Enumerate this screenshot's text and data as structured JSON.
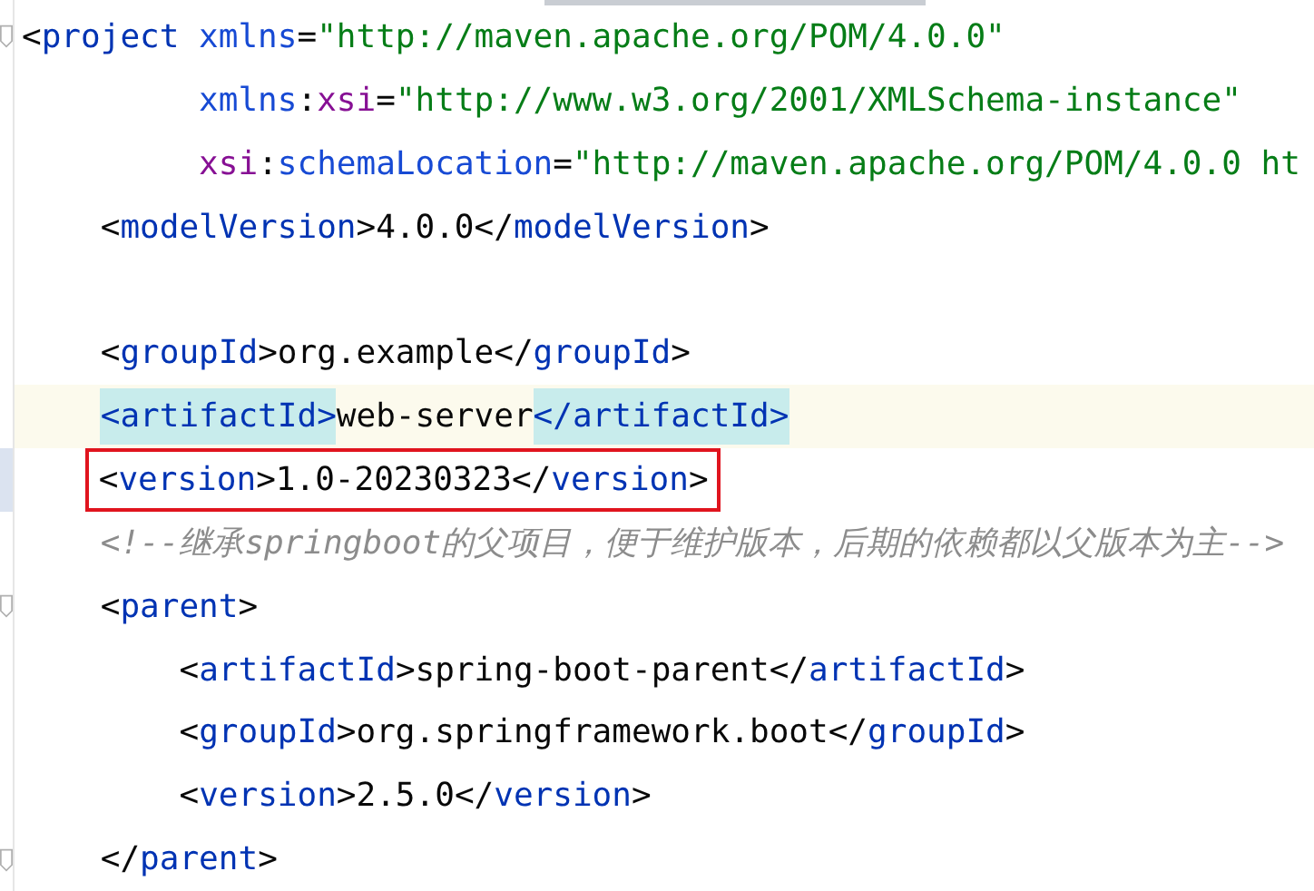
{
  "editor": {
    "lines": [
      {
        "kind": "element",
        "current": false,
        "boxed": false,
        "fold": true,
        "tokens": [
          {
            "kind": "punct",
            "text": "<"
          },
          {
            "kind": "tag",
            "text": "project"
          },
          {
            "kind": "attr",
            "text": " xmlns"
          },
          {
            "kind": "punct",
            "text": "="
          },
          {
            "kind": "value",
            "text": "\"http://maven.apache.org/POM/4.0.0\""
          }
        ],
        "children": [
          {
            "kind": "continuation",
            "current": false,
            "boxed": false,
            "fold": false,
            "tokens": [
              {
                "kind": "attr",
                "text": "xmlns"
              },
              {
                "kind": "punct",
                "text": ":"
              },
              {
                "kind": "ns",
                "text": "xsi"
              },
              {
                "kind": "punct",
                "text": "="
              },
              {
                "kind": "value",
                "text": "\"http://www.w3.org/2001/XMLSchema-instance\""
              }
            ]
          },
          {
            "kind": "continuation",
            "current": false,
            "boxed": false,
            "fold": false,
            "tokens": [
              {
                "kind": "ns",
                "text": "xsi"
              },
              {
                "kind": "punct",
                "text": ":"
              },
              {
                "kind": "attr",
                "text": "schemaLocation"
              },
              {
                "kind": "punct",
                "text": "="
              },
              {
                "kind": "value",
                "text": "\"http://maven.apache.org/POM/4.0.0 ht"
              }
            ]
          },
          {
            "kind": "element",
            "current": false,
            "boxed": false,
            "fold": false,
            "tokens": [
              {
                "kind": "punct",
                "text": "<"
              },
              {
                "kind": "tag",
                "text": "modelVersion"
              },
              {
                "kind": "punct",
                "text": ">4.0.0</"
              },
              {
                "kind": "tag",
                "text": "modelVersion"
              },
              {
                "kind": "punct",
                "text": ">"
              }
            ]
          },
          {
            "kind": "blank",
            "current": false,
            "boxed": false,
            "fold": false
          },
          {
            "kind": "element",
            "current": false,
            "boxed": false,
            "fold": false,
            "tokens": [
              {
                "kind": "punct",
                "text": "<"
              },
              {
                "kind": "tag",
                "text": "groupId"
              },
              {
                "kind": "punct",
                "text": ">org.example</"
              },
              {
                "kind": "tag",
                "text": "groupId"
              },
              {
                "kind": "punct",
                "text": ">"
              }
            ]
          },
          {
            "kind": "element",
            "current": true,
            "boxed": false,
            "fold": false,
            "tokens": [
              {
                "kind": "match",
                "text": "<artifactId>"
              },
              {
                "kind": "punct",
                "text": "web-server"
              },
              {
                "kind": "match",
                "text": "</artifactId>"
              }
            ]
          },
          {
            "kind": "element",
            "current": false,
            "boxed": true,
            "fold": false,
            "tokens": [
              {
                "kind": "punct",
                "text": "<"
              },
              {
                "kind": "tag",
                "text": "version"
              },
              {
                "kind": "punct",
                "text": ">1.0-20230323</"
              },
              {
                "kind": "tag",
                "text": "version"
              },
              {
                "kind": "punct",
                "text": ">"
              }
            ]
          },
          {
            "kind": "comment",
            "current": false,
            "boxed": false,
            "fold": false,
            "tokens": [
              {
                "kind": "comment",
                "text": "<!--继承springboot的父项目，便于维护版本，后期的依赖都以父版本为主-->"
              }
            ]
          },
          {
            "kind": "element",
            "current": false,
            "boxed": false,
            "fold": true,
            "tokens": [
              {
                "kind": "punct",
                "text": "<"
              },
              {
                "kind": "tag",
                "text": "parent"
              },
              {
                "kind": "punct",
                "text": ">"
              }
            ],
            "children": [
              {
                "kind": "element",
                "current": false,
                "boxed": false,
                "fold": false,
                "tokens": [
                  {
                    "kind": "punct",
                    "text": "<"
                  },
                  {
                    "kind": "tag",
                    "text": "artifactId"
                  },
                  {
                    "kind": "punct",
                    "text": ">spring-boot-parent</"
                  },
                  {
                    "kind": "tag",
                    "text": "artifactId"
                  },
                  {
                    "kind": "punct",
                    "text": ">"
                  }
                ]
              },
              {
                "kind": "element",
                "current": false,
                "boxed": false,
                "fold": false,
                "tokens": [
                  {
                    "kind": "punct",
                    "text": "<"
                  },
                  {
                    "kind": "tag",
                    "text": "groupId"
                  },
                  {
                    "kind": "punct",
                    "text": ">org.springframework.boot</"
                  },
                  {
                    "kind": "tag",
                    "text": "groupId"
                  },
                  {
                    "kind": "punct",
                    "text": ">"
                  }
                ]
              },
              {
                "kind": "element",
                "current": false,
                "boxed": false,
                "fold": false,
                "tokens": [
                  {
                    "kind": "punct",
                    "text": "<"
                  },
                  {
                    "kind": "tag",
                    "text": "version"
                  },
                  {
                    "kind": "punct",
                    "text": ">2.5.0</"
                  },
                  {
                    "kind": "tag",
                    "text": "version"
                  },
                  {
                    "kind": "punct",
                    "text": ">"
                  }
                ]
              }
            ]
          },
          {
            "kind": "element",
            "current": false,
            "boxed": false,
            "fold": true,
            "tokens": [
              {
                "kind": "punct",
                "text": "</"
              },
              {
                "kind": "tag",
                "text": "parent"
              },
              {
                "kind": "punct",
                "text": ">"
              }
            ]
          }
        ]
      }
    ]
  }
}
